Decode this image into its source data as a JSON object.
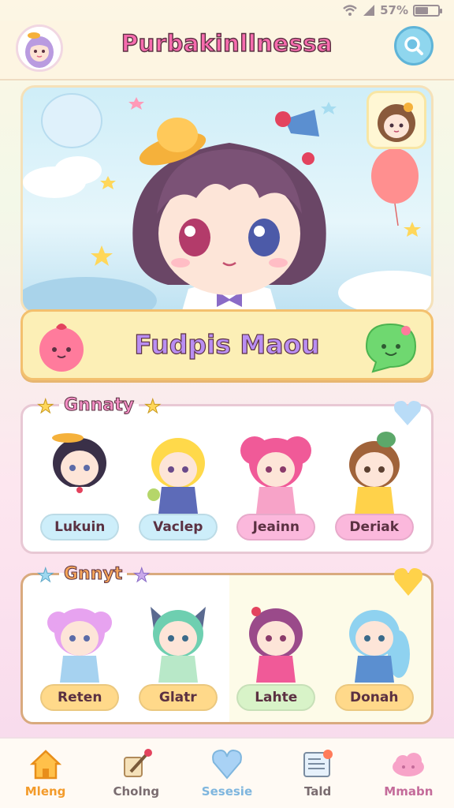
{
  "status_bar": {
    "battery_text": "57%",
    "battery_level": 0.57
  },
  "header": {
    "title": "Purbakinllnessa",
    "search_icon": "search-icon",
    "avatar": "profile-avatar"
  },
  "hero": {
    "banner_title": "Fudpis Maou"
  },
  "section1": {
    "label": "Gnnaty",
    "characters": [
      {
        "name": "Lukuin",
        "pill_color": "#cdeefa"
      },
      {
        "name": "Vaclep",
        "pill_color": "#cdeefa"
      },
      {
        "name": "Jeainn",
        "pill_color": "#fbb8dc"
      },
      {
        "name": "Deriak",
        "pill_color": "#fbb8dc"
      }
    ]
  },
  "section2": {
    "label": "Gnnyt",
    "characters": [
      {
        "name": "Reten",
        "pill_color": "#ffd98a"
      },
      {
        "name": "Glatr",
        "pill_color": "#ffd98a"
      },
      {
        "name": "Lahte",
        "pill_color": "#d8f3c8"
      },
      {
        "name": "Donah",
        "pill_color": "#ffd98a"
      }
    ]
  },
  "nav": {
    "items": [
      {
        "label": "Mleng",
        "icon": "home-icon",
        "color": "#f39b2b"
      },
      {
        "label": "Cholng",
        "icon": "paintbrush-icon",
        "color": "#7a6c70"
      },
      {
        "label": "Sesesie",
        "icon": "heart-icon",
        "color": "#7fb6de"
      },
      {
        "label": "Tald",
        "icon": "newspaper-icon",
        "color": "#7a6c70"
      },
      {
        "label": "Mmabn",
        "icon": "cloud-icon",
        "color": "#c46b9a"
      }
    ]
  },
  "colors": {
    "accent_pink": "#f76cae",
    "accent_yellow": "#fcefb6",
    "accent_blue": "#8fd6ee"
  }
}
